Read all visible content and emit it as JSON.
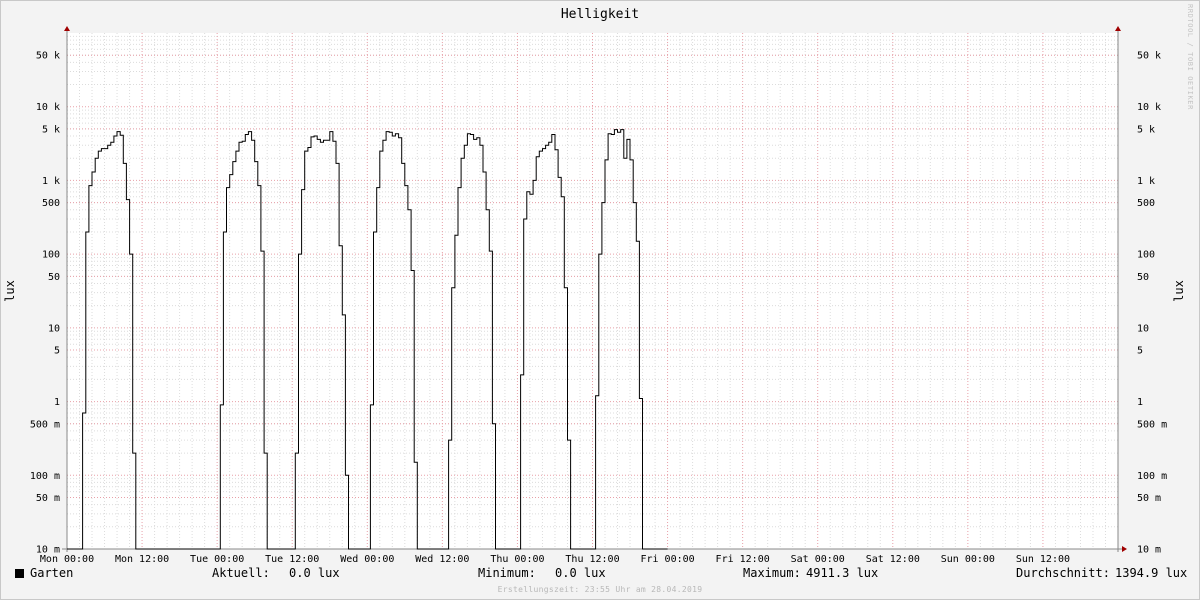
{
  "chart_data": {
    "type": "line",
    "title": "Helligkeit",
    "ylabel": "lux",
    "yscale": "log",
    "ylim": [
      0.01,
      100000
    ],
    "xlim": [
      "Mon 00:00",
      "Mon 00:00 (+7 days)"
    ],
    "x_unit": "hours since Mon 00:00",
    "grid": true,
    "legend_placement": "bottom-left",
    "x_ticks": [
      {
        "x": 0,
        "label": "Mon 00:00"
      },
      {
        "x": 12,
        "label": "Mon 12:00"
      },
      {
        "x": 24,
        "label": "Tue 00:00"
      },
      {
        "x": 36,
        "label": "Tue 12:00"
      },
      {
        "x": 48,
        "label": "Wed 00:00"
      },
      {
        "x": 60,
        "label": "Wed 12:00"
      },
      {
        "x": 72,
        "label": "Thu 00:00"
      },
      {
        "x": 84,
        "label": "Thu 12:00"
      },
      {
        "x": 96,
        "label": "Fri 00:00"
      },
      {
        "x": 108,
        "label": "Fri 12:00"
      },
      {
        "x": 120,
        "label": "Sat 00:00"
      },
      {
        "x": 132,
        "label": "Sat 12:00"
      },
      {
        "x": 144,
        "label": "Sun 00:00"
      },
      {
        "x": 156,
        "label": "Sun 12:00"
      }
    ],
    "y_ticks": [
      {
        "v": 0.01,
        "label": "10 m"
      },
      {
        "v": 0.05,
        "label": "50 m"
      },
      {
        "v": 0.1,
        "label": "100 m"
      },
      {
        "v": 0.5,
        "label": "500 m"
      },
      {
        "v": 1,
        "label": "1"
      },
      {
        "v": 5,
        "label": "5"
      },
      {
        "v": 10,
        "label": "10"
      },
      {
        "v": 50,
        "label": "50"
      },
      {
        "v": 100,
        "label": "100"
      },
      {
        "v": 500,
        "label": "500"
      },
      {
        "v": 1000,
        "label": "1 k"
      },
      {
        "v": 5000,
        "label": "5 k"
      },
      {
        "v": 10000,
        "label": "10 k"
      },
      {
        "v": 50000,
        "label": "50 k"
      }
    ],
    "colors": {
      "line": "#000000",
      "grid_major": "#e8a0a8",
      "grid_minor": "#dcdcdc",
      "axis": "#888888",
      "arrow": "#a00000"
    },
    "series": [
      {
        "name": "Garten",
        "points": [
          [
            0,
            0.01
          ],
          [
            2.5,
            0.01
          ],
          [
            2.5,
            0.7
          ],
          [
            3.0,
            0.7
          ],
          [
            3.0,
            200
          ],
          [
            3.5,
            200
          ],
          [
            3.5,
            850
          ],
          [
            4.0,
            850
          ],
          [
            4.0,
            1300
          ],
          [
            4.5,
            1300
          ],
          [
            4.5,
            2000
          ],
          [
            5.0,
            2000
          ],
          [
            5.0,
            2500
          ],
          [
            5.5,
            2500
          ],
          [
            5.5,
            2700
          ],
          [
            6.5,
            2700
          ],
          [
            6.5,
            3000
          ],
          [
            7.0,
            3000
          ],
          [
            7.0,
            3300
          ],
          [
            7.5,
            3300
          ],
          [
            7.5,
            4000
          ],
          [
            8.0,
            4000
          ],
          [
            8.0,
            4600
          ],
          [
            8.5,
            4600
          ],
          [
            8.5,
            4100
          ],
          [
            9.0,
            4100
          ],
          [
            9.0,
            1700
          ],
          [
            9.5,
            1700
          ],
          [
            9.5,
            550
          ],
          [
            10.0,
            550
          ],
          [
            10.0,
            100
          ],
          [
            10.5,
            100
          ],
          [
            10.5,
            0.2
          ],
          [
            11.0,
            0.2
          ],
          [
            11.0,
            0.01
          ],
          [
            24.5,
            0.01
          ],
          [
            24.5,
            0.9
          ],
          [
            25.0,
            0.9
          ],
          [
            25.0,
            200
          ],
          [
            25.5,
            200
          ],
          [
            25.5,
            800
          ],
          [
            26.0,
            800
          ],
          [
            26.0,
            1200
          ],
          [
            26.5,
            1200
          ],
          [
            26.5,
            1800
          ],
          [
            27.0,
            1800
          ],
          [
            27.0,
            2500
          ],
          [
            27.5,
            2500
          ],
          [
            27.5,
            3300
          ],
          [
            28.0,
            3300
          ],
          [
            28.0,
            3400
          ],
          [
            28.5,
            3400
          ],
          [
            28.5,
            4200
          ],
          [
            29.0,
            4200
          ],
          [
            29.0,
            4600
          ],
          [
            29.5,
            4600
          ],
          [
            29.5,
            3500
          ],
          [
            30.0,
            3500
          ],
          [
            30.0,
            1800
          ],
          [
            30.5,
            1800
          ],
          [
            30.5,
            850
          ],
          [
            31.0,
            850
          ],
          [
            31.0,
            110
          ],
          [
            31.5,
            110
          ],
          [
            31.5,
            0.2
          ],
          [
            32.0,
            0.2
          ],
          [
            32.0,
            0.01
          ],
          [
            36.5,
            0.01
          ],
          [
            36.5,
            0.2
          ],
          [
            37.0,
            0.2
          ],
          [
            37.0,
            100
          ],
          [
            37.5,
            100
          ],
          [
            37.5,
            750
          ],
          [
            38.0,
            750
          ],
          [
            38.0,
            2500
          ],
          [
            38.5,
            2500
          ],
          [
            38.5,
            2800
          ],
          [
            39.0,
            2800
          ],
          [
            39.0,
            3900
          ],
          [
            39.5,
            3900
          ],
          [
            39.5,
            4000
          ],
          [
            40.0,
            4000
          ],
          [
            40.0,
            3600
          ],
          [
            40.5,
            3600
          ],
          [
            40.5,
            3300
          ],
          [
            41.0,
            3300
          ],
          [
            41.0,
            3500
          ],
          [
            42.0,
            3500
          ],
          [
            42.0,
            4600
          ],
          [
            42.5,
            4600
          ],
          [
            42.5,
            3400
          ],
          [
            43.0,
            3400
          ],
          [
            43.0,
            1700
          ],
          [
            43.5,
            1700
          ],
          [
            43.5,
            130
          ],
          [
            44.0,
            130
          ],
          [
            44.0,
            15
          ],
          [
            44.5,
            15
          ],
          [
            44.5,
            0.1
          ],
          [
            45.0,
            0.1
          ],
          [
            45.0,
            0.01
          ],
          [
            48.5,
            0.01
          ],
          [
            48.5,
            0.9
          ],
          [
            49.0,
            0.9
          ],
          [
            49.0,
            200
          ],
          [
            49.5,
            200
          ],
          [
            49.5,
            800
          ],
          [
            50.0,
            800
          ],
          [
            50.0,
            2500
          ],
          [
            50.5,
            2500
          ],
          [
            50.5,
            3500
          ],
          [
            51.0,
            3500
          ],
          [
            51.0,
            4600
          ],
          [
            51.5,
            4600
          ],
          [
            51.5,
            4500
          ],
          [
            52.0,
            4500
          ],
          [
            52.0,
            4000
          ],
          [
            52.5,
            4000
          ],
          [
            52.5,
            4300
          ],
          [
            53.0,
            4300
          ],
          [
            53.0,
            3800
          ],
          [
            53.5,
            3800
          ],
          [
            53.5,
            1700
          ],
          [
            54.0,
            1700
          ],
          [
            54.0,
            850
          ],
          [
            54.5,
            850
          ],
          [
            54.5,
            400
          ],
          [
            55.0,
            400
          ],
          [
            55.0,
            60
          ],
          [
            55.5,
            60
          ],
          [
            55.5,
            0.15
          ],
          [
            56.0,
            0.15
          ],
          [
            56.0,
            0.01
          ],
          [
            61.0,
            0.01
          ],
          [
            61.0,
            0.3
          ],
          [
            61.5,
            0.3
          ],
          [
            61.5,
            35
          ],
          [
            62.0,
            35
          ],
          [
            62.0,
            180
          ],
          [
            62.5,
            180
          ],
          [
            62.5,
            800
          ],
          [
            63.0,
            800
          ],
          [
            63.0,
            2000
          ],
          [
            63.5,
            2000
          ],
          [
            63.5,
            3000
          ],
          [
            64.0,
            3000
          ],
          [
            64.0,
            4300
          ],
          [
            64.5,
            4300
          ],
          [
            64.5,
            4200
          ],
          [
            65.0,
            4200
          ],
          [
            65.0,
            3600
          ],
          [
            65.5,
            3600
          ],
          [
            65.5,
            3800
          ],
          [
            66.0,
            3800
          ],
          [
            66.0,
            3000
          ],
          [
            66.5,
            3000
          ],
          [
            66.5,
            1300
          ],
          [
            67.0,
            1300
          ],
          [
            67.0,
            400
          ],
          [
            67.5,
            400
          ],
          [
            67.5,
            110
          ],
          [
            68.0,
            110
          ],
          [
            68.0,
            0.5
          ],
          [
            68.5,
            0.5
          ],
          [
            68.5,
            0.01
          ],
          [
            72.5,
            0.01
          ],
          [
            72.5,
            2.3
          ],
          [
            73.0,
            2.3
          ],
          [
            73.0,
            300
          ],
          [
            73.5,
            300
          ],
          [
            73.5,
            700
          ],
          [
            74.0,
            700
          ],
          [
            74.0,
            650
          ],
          [
            74.5,
            650
          ],
          [
            74.5,
            1000
          ],
          [
            75.0,
            1000
          ],
          [
            75.0,
            2100
          ],
          [
            75.5,
            2100
          ],
          [
            75.5,
            2500
          ],
          [
            76.0,
            2500
          ],
          [
            76.0,
            2700
          ],
          [
            76.5,
            2700
          ],
          [
            76.5,
            3000
          ],
          [
            77.0,
            3000
          ],
          [
            77.0,
            3300
          ],
          [
            77.5,
            3300
          ],
          [
            77.5,
            4200
          ],
          [
            78.0,
            4200
          ],
          [
            78.0,
            2600
          ],
          [
            78.5,
            2600
          ],
          [
            78.5,
            1100
          ],
          [
            79.0,
            1100
          ],
          [
            79.0,
            600
          ],
          [
            79.5,
            600
          ],
          [
            79.5,
            35
          ],
          [
            80.0,
            35
          ],
          [
            80.0,
            0.3
          ],
          [
            80.5,
            0.3
          ],
          [
            80.5,
            0.01
          ],
          [
            84.5,
            0.01
          ],
          [
            84.5,
            1.2
          ],
          [
            85.0,
            1.2
          ],
          [
            85.0,
            100
          ],
          [
            85.5,
            100
          ],
          [
            85.5,
            500
          ],
          [
            86.0,
            500
          ],
          [
            86.0,
            1900
          ],
          [
            86.5,
            1900
          ],
          [
            86.5,
            4300
          ],
          [
            87.0,
            4300
          ],
          [
            87.0,
            4200
          ],
          [
            87.5,
            4200
          ],
          [
            87.5,
            4900
          ],
          [
            88.0,
            4900
          ],
          [
            88.0,
            4500
          ],
          [
            88.5,
            4500
          ],
          [
            88.5,
            4900
          ],
          [
            89.0,
            4900
          ],
          [
            89.0,
            2000
          ],
          [
            89.5,
            2000
          ],
          [
            89.5,
            3600
          ],
          [
            90.0,
            3600
          ],
          [
            90.0,
            1900
          ],
          [
            90.5,
            1900
          ],
          [
            90.5,
            500
          ],
          [
            91.0,
            500
          ],
          [
            91.0,
            150
          ],
          [
            91.5,
            150
          ],
          [
            91.5,
            1.1
          ],
          [
            92.0,
            1.1
          ],
          [
            92.0,
            0.01
          ],
          [
            96.0,
            0.01
          ]
        ]
      }
    ]
  },
  "legend": {
    "series_name": "Garten",
    "current_label": "Aktuell:",
    "current_value": "0.0 lux",
    "min_label": "Minimum:",
    "min_value": "0.0 lux",
    "max_label": "Maximum:",
    "max_value": "4911.3 lux",
    "avg_label": "Durchschnitt:",
    "avg_value": "1394.9 lux"
  },
  "footer_text": "Erstellungszeit: 23:55 Uhr am 28.04.2019",
  "watermark": "RRDTOOL / TOBI OETIKER"
}
